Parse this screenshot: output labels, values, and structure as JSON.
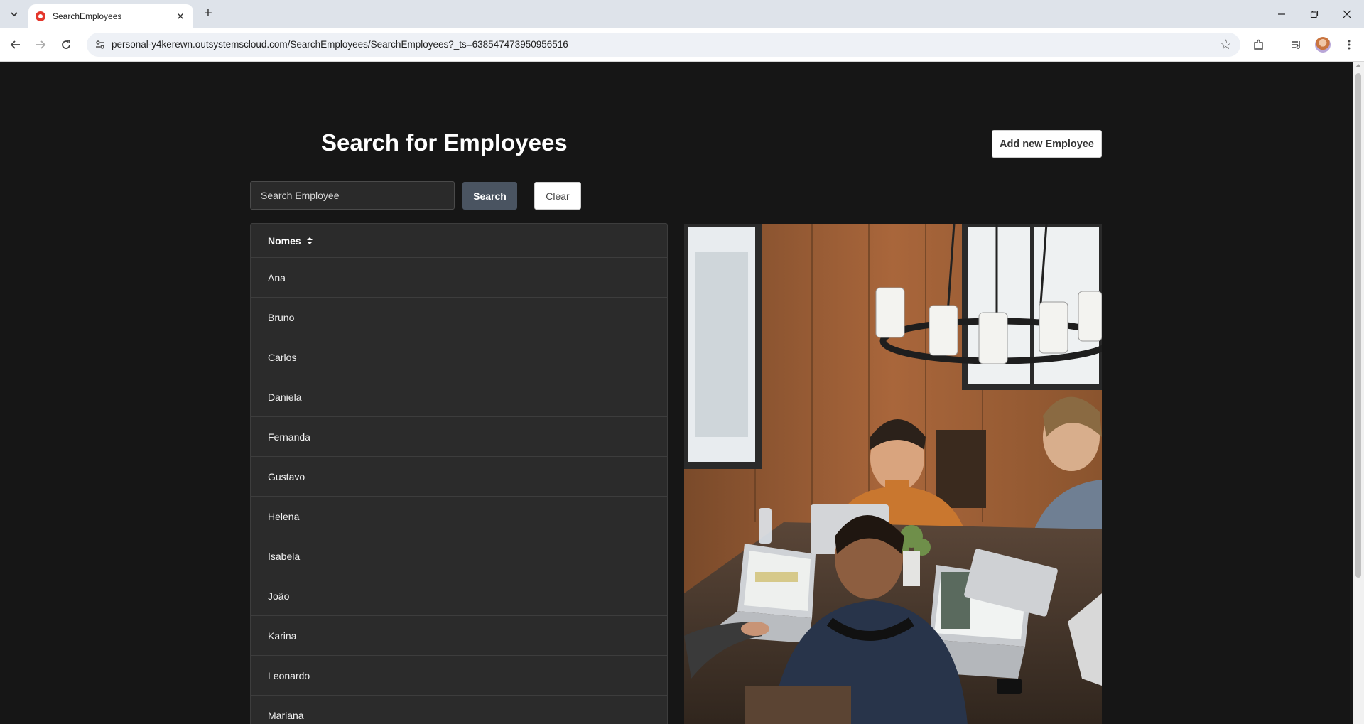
{
  "browser": {
    "tab_title": "SearchEmployees",
    "url": "personal-y4kerewn.outsystemscloud.com/SearchEmployees/SearchEmployees?_ts=638547473950956516"
  },
  "page": {
    "title": "Search for Employees",
    "add_button": "Add new Employee",
    "search": {
      "placeholder": "Search Employee",
      "value": "",
      "button": "Search",
      "clear": "Clear"
    },
    "table": {
      "header": "Nomes",
      "rows": [
        "Ana",
        "Bruno",
        "Carlos",
        "Daniela",
        "Fernanda",
        "Gustavo",
        "Helena",
        "Isabela",
        "João",
        "Karina",
        "Leonardo",
        "Mariana"
      ]
    },
    "colors": {
      "background": "#161616",
      "panel": "#2b2b2b",
      "search_button": "#4a5461"
    }
  }
}
